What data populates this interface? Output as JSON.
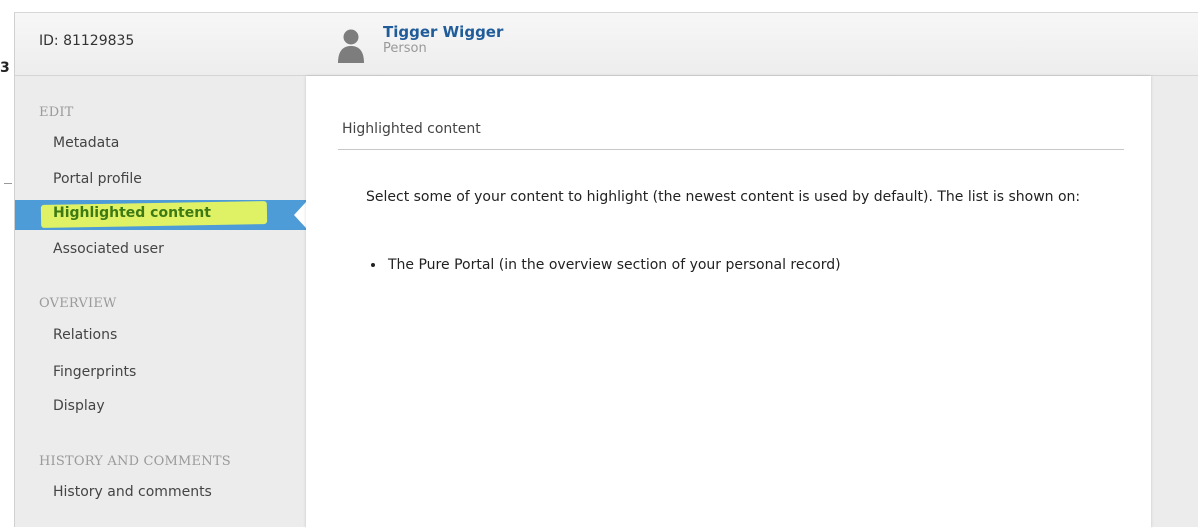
{
  "header": {
    "id_label": "ID: 81129835",
    "person_name": "Tigger Wigger",
    "person_type": "Person"
  },
  "stray": {
    "char": "3"
  },
  "sidebar": {
    "sections": [
      {
        "title": "EDIT",
        "items": [
          "Metadata",
          "Portal profile",
          "Highlighted content",
          "Associated user"
        ]
      },
      {
        "title": "OVERVIEW",
        "items": [
          "Relations",
          "Fingerprints",
          "Display"
        ]
      },
      {
        "title": "HISTORY AND COMMENTS",
        "items": [
          "History and comments"
        ]
      }
    ],
    "active_item": "Highlighted content"
  },
  "main": {
    "title": "Highlighted content",
    "description": "Select some of your content to highlight (the newest content is used by default). The list is shown on:",
    "list": [
      "The Pure Portal (in the overview section of your personal record)"
    ]
  },
  "icons": {
    "person": "person-silhouette-icon"
  },
  "colors": {
    "active_bg": "#4d9bd7",
    "highlight_marker": "#dff266",
    "active_text": "#3d7a14",
    "name_link": "#1f5c99"
  }
}
